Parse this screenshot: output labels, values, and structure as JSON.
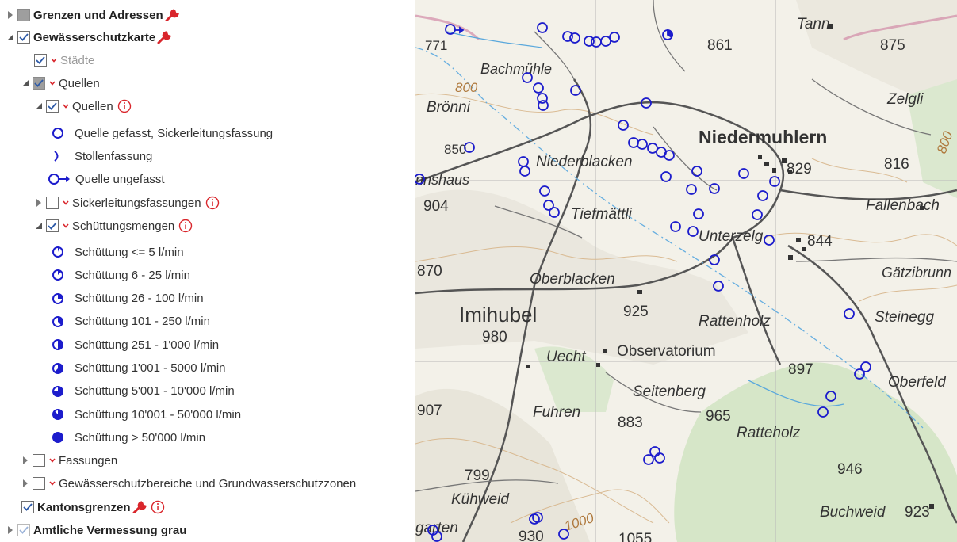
{
  "layer_tree": {
    "grenzen": {
      "label": "Grenzen und Adressen"
    },
    "gewaesser": {
      "label": "Gewässerschutzkarte"
    },
    "staedte": {
      "label": "Städte"
    },
    "quellen_group": {
      "label": "Quellen"
    },
    "quellen": {
      "label": "Quellen"
    },
    "quellen_legend": [
      {
        "label": "Quelle gefasst, Sickerleitungsfassung",
        "icon": "circle-open-icon"
      },
      {
        "label": "Stollenfassung",
        "icon": "bracket-icon"
      },
      {
        "label": "Quelle ungefasst",
        "icon": "circle-arrow-icon"
      }
    ],
    "sickerleitung": {
      "label": "Sickerleitungsfassungen"
    },
    "schuettung": {
      "label": "Schüttungsmengen"
    },
    "schuettung_legend": [
      {
        "label": "Schüttung <= 5 l/min",
        "fill": 0.05
      },
      {
        "label": "Schüttung 6 - 25 l/min",
        "fill": 0.125
      },
      {
        "label": "Schüttung 26 - 100 l/min",
        "fill": 0.25
      },
      {
        "label": "Schüttung 101 - 250 l/min",
        "fill": 0.375
      },
      {
        "label": "Schüttung 251 - 1'000 l/min",
        "fill": 0.5
      },
      {
        "label": "Schüttung 1'001 - 5000 l/min",
        "fill": 0.625
      },
      {
        "label": "Schüttung 5'001 - 10'000 l/min",
        "fill": 0.75
      },
      {
        "label": "Schüttung 10'001 - 50'000 l/min",
        "fill": 0.875
      },
      {
        "label": "Schüttung > 50'000 l/min",
        "fill": 1.0
      }
    ],
    "fassungen": {
      "label": "Fassungen"
    },
    "schutzbereiche": {
      "label": "Gewässerschutzbereiche und Grundwasserschutzzonen"
    },
    "kantonsgrenzen": {
      "label": "Kantonsgrenzen"
    },
    "vermessung": {
      "label": "Amtliche Vermessung grau"
    }
  },
  "colors": {
    "accent_red": "#d9262c",
    "symbol_blue": "#1c1ccc",
    "map_bg": "#f3f1e9",
    "forest": "#d6e6c8"
  },
  "map": {
    "labels": {
      "tann": "Tann",
      "e861": "861",
      "e875": "875",
      "e771": "771",
      "bachmuehle": "Bachmühle",
      "e800a": "800",
      "broenni": "Brönni",
      "zelgli": "Zelgli",
      "niedermuhlern": "Niedermuhlern",
      "e800b": "800",
      "e850": "850",
      "niederblacken": "Niederblacken",
      "e829": "829",
      "e816": "816",
      "nnshaus": "nnshaus",
      "e904": "904",
      "tiefmaettli": "Tiefmättli",
      "fallenbach": "Fallenbach",
      "unterzelg": "Unterzelg",
      "e844": "844",
      "e870": "870",
      "oberblacken": "Oberblacken",
      "gaetzibrunn": "Gätzibrunn",
      "imihubel": "Imihubel",
      "e925": "925",
      "rattenholz": "Rattenholz",
      "steinegg": "Steinegg",
      "e980": "980",
      "uecht": "Uecht",
      "observatorium": "Observatorium",
      "e897": "897",
      "oberfeld": "Oberfeld",
      "seitenberg": "Seitenberg",
      "e907": "907",
      "fuhren": "Fuhren",
      "e883": "883",
      "e965": "965",
      "ratteholz": "Ratteholz",
      "e799": "799",
      "e946": "946",
      "kuehweid": "Kühweid",
      "e1000": "1000",
      "buchweid": "Buchweid",
      "e923": "923",
      "garten": "garten",
      "e930": "930",
      "e1055": "1055"
    }
  }
}
